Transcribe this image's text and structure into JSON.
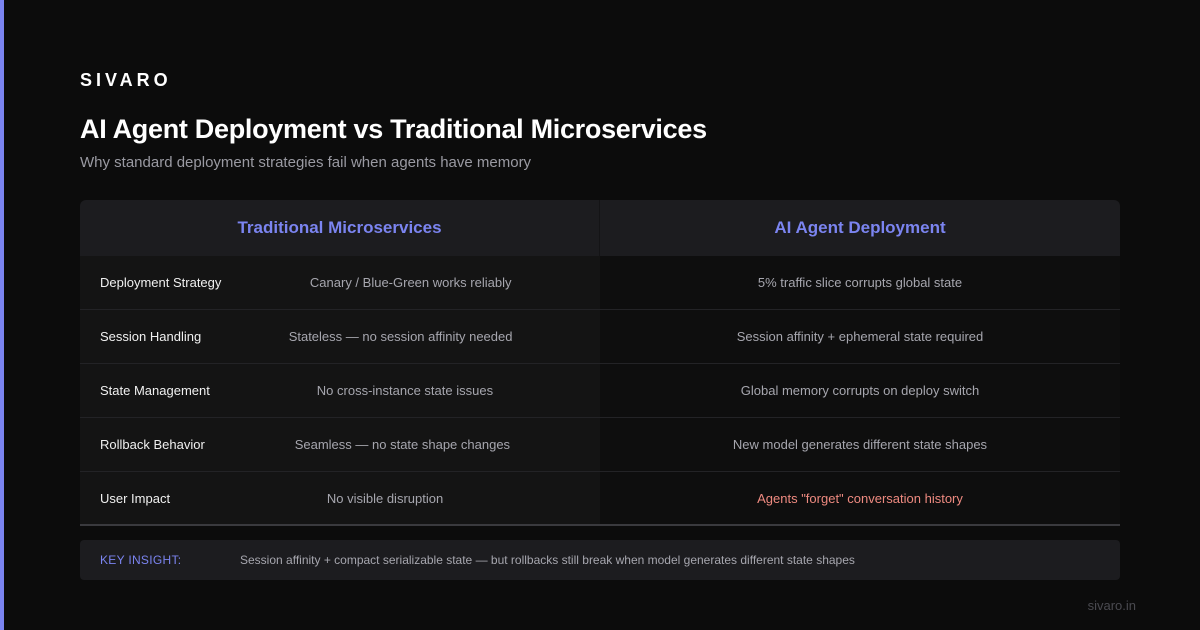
{
  "brand": "SIVARO",
  "title": "AI Agent Deployment vs Traditional Microservices",
  "subtitle": "Why standard deployment strategies fail when agents have memory",
  "table": {
    "headers": [
      "Traditional Microservices",
      "AI Agent Deployment"
    ],
    "rows": [
      {
        "label": "Deployment Strategy",
        "traditional": "Canary / Blue-Green works reliably",
        "agent": "5% traffic slice corrupts global state"
      },
      {
        "label": "Session Handling",
        "traditional": "Stateless — no session affinity needed",
        "agent": "Session affinity + ephemeral state required"
      },
      {
        "label": "State Management",
        "traditional": "No cross-instance state issues",
        "agent": "Global memory corrupts on deploy switch"
      },
      {
        "label": "Rollback Behavior",
        "traditional": "Seamless — no state shape changes",
        "agent": "New model generates different state shapes"
      },
      {
        "label": "User Impact",
        "traditional": "No visible disruption",
        "agent": "Agents \"forget\" conversation history"
      }
    ]
  },
  "insight": {
    "label": "KEY INSIGHT:",
    "text": "Session affinity + compact serializable state — but rollbacks still break when model generates different state shapes"
  },
  "footer": "sivaro.in",
  "colors": {
    "accent": "#7b84f0",
    "warning": "#ee8a80",
    "background": "#0c0c0c"
  }
}
